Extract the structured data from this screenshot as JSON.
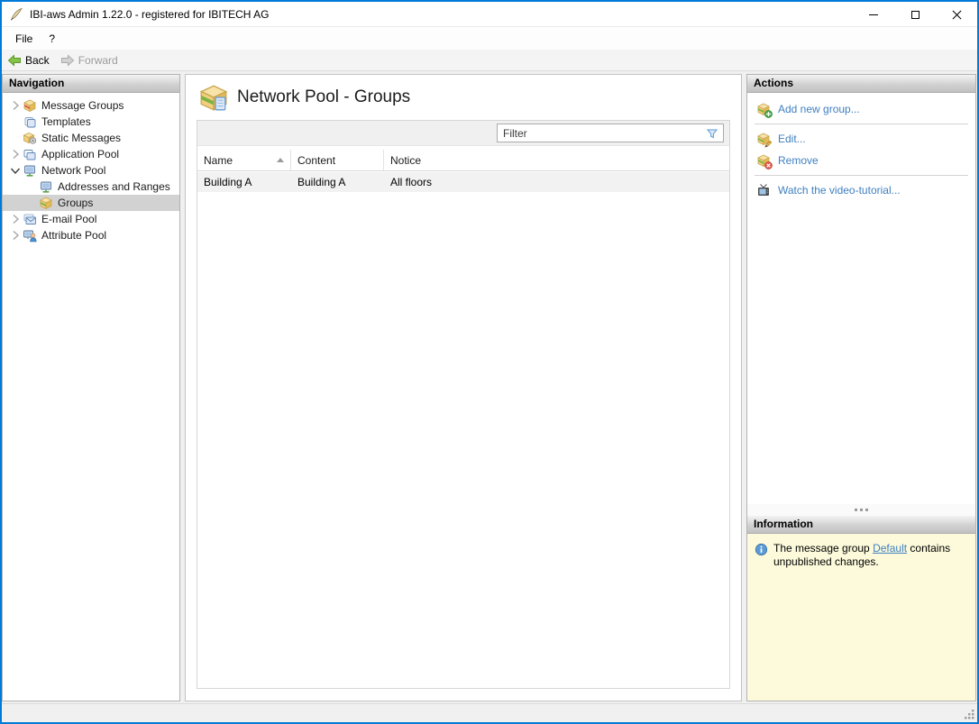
{
  "window": {
    "title": "IBI-aws Admin 1.22.0 - registered for IBITECH AG",
    "controls": [
      {
        "name": "minimize"
      },
      {
        "name": "maximize"
      },
      {
        "name": "close"
      }
    ]
  },
  "menu": {
    "items": [
      {
        "label": "File"
      },
      {
        "label": "?"
      }
    ]
  },
  "toolbar": {
    "back_label": "Back",
    "forward_label": "Forward",
    "forward_enabled": false
  },
  "navigation": {
    "header": "Navigation",
    "items": [
      {
        "label": "Message Groups",
        "level": 0,
        "expander": "collapsed",
        "icon": "message-groups-box-icon",
        "selected": false
      },
      {
        "label": "Templates",
        "level": 0,
        "expander": "none",
        "icon": "templates-pages-icon",
        "selected": false
      },
      {
        "label": "Static Messages",
        "level": 0,
        "expander": "none",
        "icon": "static-messages-gear-box-icon",
        "selected": false
      },
      {
        "label": "Application Pool",
        "level": 0,
        "expander": "collapsed",
        "icon": "application-windows-icon",
        "selected": false
      },
      {
        "label": "Network Pool",
        "level": 0,
        "expander": "expanded",
        "icon": "network-monitor-icon",
        "selected": false
      },
      {
        "label": "Addresses and Ranges",
        "level": 1,
        "expander": "none",
        "icon": "monitor-icon",
        "selected": false
      },
      {
        "label": "Groups",
        "level": 1,
        "expander": "none",
        "icon": "group-box-icon",
        "selected": true
      },
      {
        "label": "E-mail Pool",
        "level": 0,
        "expander": "collapsed",
        "icon": "envelope-icon",
        "selected": false
      },
      {
        "label": "Attribute Pool",
        "level": 0,
        "expander": "collapsed",
        "icon": "person-monitor-icon",
        "selected": false
      }
    ]
  },
  "main": {
    "title": "Network Pool - Groups",
    "title_icon": "group-box-document-icon",
    "filter": {
      "placeholder": "Filter",
      "icon": "filter-funnel-icon"
    },
    "table": {
      "columns": [
        {
          "label": "Name",
          "sort": "asc"
        },
        {
          "label": "Content",
          "sort": null
        },
        {
          "label": "Notice",
          "sort": null
        }
      ],
      "rows": [
        {
          "name": "Building A",
          "content": "Building A",
          "notice": "All floors"
        }
      ]
    }
  },
  "actions": {
    "header": "Actions",
    "items": [
      {
        "label": "Add new group...",
        "icon": "group-add-icon"
      },
      {
        "label": "Edit...",
        "icon": "group-edit-icon"
      },
      {
        "label": "Remove",
        "icon": "group-remove-icon"
      },
      {
        "label": "Watch the video-tutorial...",
        "icon": "tv-icon"
      }
    ]
  },
  "information": {
    "header": "Information",
    "icon": "info-circle-icon",
    "message_before": "The message group ",
    "link_label": "Default",
    "message_after": " contains unpublished changes."
  },
  "colors": {
    "accent_border": "#0079d7",
    "link": "#3f7fc1",
    "info_background": "#fcfadb",
    "tree_selection": "#d2d2d2",
    "panel_header_gradient_top": "#f3f3f3",
    "panel_header_gradient_bottom": "#c1c1c1",
    "row_shade": "#f2f2f2"
  }
}
